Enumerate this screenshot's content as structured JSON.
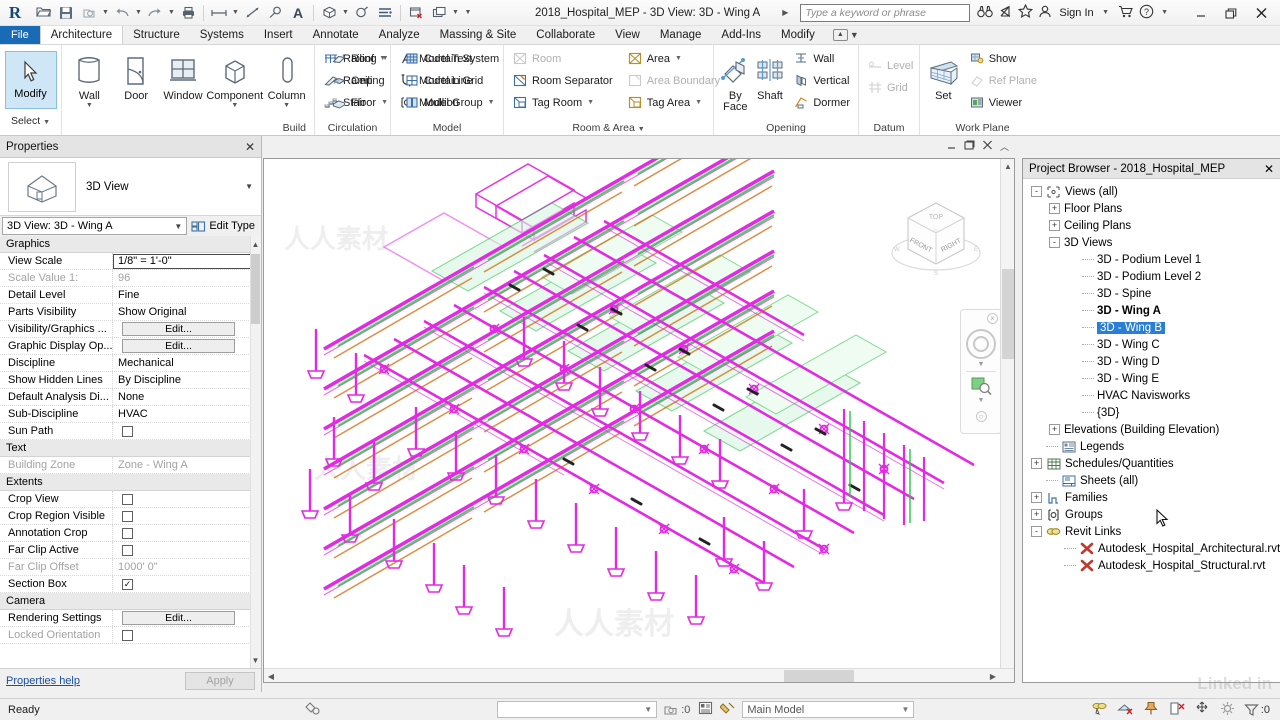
{
  "app": {
    "document_title": "2018_Hospital_MEP - 3D View: 3D - Wing A",
    "search_placeholder": "Type a keyword or phrase",
    "sign_in": "Sign In"
  },
  "quick_access": [
    {
      "name": "open-icon",
      "glyph": "↗"
    },
    {
      "name": "save-icon",
      "glyph": "ὋE"
    },
    {
      "name": "save-as-icon",
      "glyph": "⬚"
    },
    {
      "name": "undo-icon",
      "glyph": "↶"
    },
    {
      "name": "redo-icon",
      "glyph": "↷"
    },
    {
      "name": "print-icon",
      "glyph": "⎙"
    },
    {
      "name": "measure-icon",
      "glyph": "↔"
    },
    {
      "name": "aligned-dimension-icon",
      "glyph": "⤡"
    },
    {
      "name": "tag-icon",
      "glyph": "ⓘ"
    },
    {
      "name": "text-icon",
      "glyph": "A"
    },
    {
      "name": "default-3d-view-icon",
      "glyph": "⬜"
    },
    {
      "name": "section-icon",
      "glyph": "○"
    },
    {
      "name": "thin-lines-icon",
      "glyph": "≡"
    },
    {
      "name": "close-hidden-windows-icon",
      "glyph": "▧"
    },
    {
      "name": "switch-windows-icon",
      "glyph": "❐"
    }
  ],
  "ribbon": {
    "file_tab": "File",
    "tabs": [
      "Architecture",
      "Structure",
      "Systems",
      "Insert",
      "Annotate",
      "Analyze",
      "Massing & Site",
      "Collaborate",
      "View",
      "Manage",
      "Add-Ins",
      "Modify"
    ],
    "active_tab": "Architecture",
    "select_panel": {
      "modify_label": "Modify",
      "select_label": "Select",
      "title": ""
    },
    "panels": [
      {
        "title": "Build",
        "big_buttons": [
          {
            "label": "Wall",
            "icon": "wall-icon",
            "has_caret": true
          },
          {
            "label": "Door",
            "icon": "door-icon",
            "has_caret": false
          },
          {
            "label": "Window",
            "icon": "window-icon",
            "has_caret": false
          },
          {
            "label": "Component",
            "icon": "component-icon",
            "has_caret": true
          },
          {
            "label": "Column",
            "icon": "column-icon",
            "has_caret": true
          }
        ],
        "columns": [
          [
            {
              "label": "Roof",
              "icon": "roof-icon",
              "caret": true,
              "disabled": false
            },
            {
              "label": "Ceiling",
              "icon": "ceiling-icon",
              "caret": false,
              "disabled": false
            },
            {
              "label": "Floor",
              "icon": "floor-icon",
              "caret": true,
              "disabled": false
            }
          ],
          [
            {
              "label": "Curtain System",
              "icon": "curtain-system-icon",
              "caret": false,
              "disabled": false
            },
            {
              "label": "Curtain Grid",
              "icon": "curtain-grid-icon",
              "caret": false,
              "disabled": false
            },
            {
              "label": "Mullion",
              "icon": "mullion-icon",
              "caret": false,
              "disabled": false
            }
          ]
        ]
      },
      {
        "title": "Circulation",
        "big_buttons": [],
        "columns": [
          [
            {
              "label": "Railing",
              "icon": "railing-icon",
              "caret": true,
              "disabled": false
            },
            {
              "label": "Ramp",
              "icon": "ramp-icon",
              "caret": false,
              "disabled": false
            },
            {
              "label": "Stair",
              "icon": "stair-icon",
              "caret": false,
              "disabled": false
            }
          ]
        ]
      },
      {
        "title": "Model",
        "big_buttons": [],
        "columns": [
          [
            {
              "label": "Model Text",
              "icon": "model-text-icon",
              "caret": false,
              "disabled": false
            },
            {
              "label": "Model Line",
              "icon": "model-line-icon",
              "caret": false,
              "disabled": false
            },
            {
              "label": "Model Group",
              "icon": "model-group-icon",
              "caret": true,
              "disabled": false
            }
          ]
        ]
      },
      {
        "title": "Room & Area",
        "big_buttons": [],
        "columns": [
          [
            {
              "label": "Room",
              "icon": "room-icon",
              "caret": false,
              "disabled": true
            },
            {
              "label": "Room Separator",
              "icon": "room-separator-icon",
              "caret": false,
              "disabled": false
            },
            {
              "label": "Tag Room",
              "icon": "tag-room-icon",
              "caret": true,
              "disabled": false
            }
          ],
          [
            {
              "label": "Area",
              "icon": "area-icon",
              "caret": true,
              "disabled": false
            },
            {
              "label": "Area Boundary",
              "icon": "area-boundary-icon",
              "caret": false,
              "disabled": true
            },
            {
              "label": "Tag Area",
              "icon": "tag-area-icon",
              "caret": true,
              "disabled": false
            }
          ]
        ]
      },
      {
        "title": "Opening",
        "big_buttons": [
          {
            "label": "By Face",
            "icon": "by-face-icon",
            "has_caret": false
          },
          {
            "label": "Shaft",
            "icon": "shaft-icon",
            "has_caret": false
          }
        ],
        "columns": [
          [
            {
              "label": "Wall",
              "icon": "wall-opening-icon",
              "caret": false,
              "disabled": false
            },
            {
              "label": "Vertical",
              "icon": "vertical-opening-icon",
              "caret": false,
              "disabled": false
            },
            {
              "label": "Dormer",
              "icon": "dormer-opening-icon",
              "caret": false,
              "disabled": false
            }
          ]
        ]
      },
      {
        "title": "Datum",
        "big_buttons": [],
        "columns": [
          [
            {
              "label": "Level",
              "icon": "level-icon",
              "caret": false,
              "disabled": true
            },
            {
              "label": "Grid",
              "icon": "grid-icon",
              "caret": false,
              "disabled": true
            }
          ]
        ]
      },
      {
        "title": "Work Plane",
        "big_buttons": [
          {
            "label": "Set",
            "icon": "set-workplane-icon",
            "has_caret": false
          }
        ],
        "columns": [
          [
            {
              "label": "Show",
              "icon": "show-workplane-icon",
              "caret": false,
              "disabled": false
            },
            {
              "label": "Ref Plane",
              "icon": "ref-plane-icon",
              "caret": false,
              "disabled": true
            },
            {
              "label": "Viewer",
              "icon": "workplane-viewer-icon",
              "caret": false,
              "disabled": false
            }
          ]
        ]
      }
    ]
  },
  "properties": {
    "panel_title": "Properties",
    "type_label": "3D View",
    "selector_value": "3D View: 3D - Wing A",
    "edit_type_label": "Edit Type",
    "help_label": "Properties help",
    "apply_label": "Apply",
    "sections": [
      {
        "name": "Graphics",
        "rows": [
          {
            "name": "View Scale",
            "value": "1/8\" = 1'-0\"",
            "kind": "boxed",
            "disabled": false
          },
          {
            "name": "Scale Value    1:",
            "value": "96",
            "kind": "text",
            "disabled": true
          },
          {
            "name": "Detail Level",
            "value": "Fine",
            "kind": "text",
            "disabled": false
          },
          {
            "name": "Parts Visibility",
            "value": "Show Original",
            "kind": "text",
            "disabled": false
          },
          {
            "name": "Visibility/Graphics ...",
            "value": "Edit...",
            "kind": "button",
            "disabled": false
          },
          {
            "name": "Graphic Display Op...",
            "value": "Edit...",
            "kind": "button",
            "disabled": false
          },
          {
            "name": "Discipline",
            "value": "Mechanical",
            "kind": "text",
            "disabled": false
          },
          {
            "name": "Show Hidden Lines",
            "value": "By Discipline",
            "kind": "text",
            "disabled": false
          },
          {
            "name": "Default Analysis Di...",
            "value": "None",
            "kind": "text",
            "disabled": false
          },
          {
            "name": "Sub-Discipline",
            "value": "HVAC",
            "kind": "text",
            "disabled": false
          },
          {
            "name": "Sun Path",
            "value": "",
            "kind": "checkbox",
            "checked": false,
            "disabled": false
          }
        ]
      },
      {
        "name": "Text",
        "rows": [
          {
            "name": "Building Zone",
            "value": "Zone - Wing A",
            "kind": "text",
            "disabled": true
          }
        ]
      },
      {
        "name": "Extents",
        "rows": [
          {
            "name": "Crop View",
            "value": "",
            "kind": "checkbox",
            "checked": false,
            "disabled": false
          },
          {
            "name": "Crop Region Visible",
            "value": "",
            "kind": "checkbox",
            "checked": false,
            "disabled": false
          },
          {
            "name": "Annotation Crop",
            "value": "",
            "kind": "checkbox",
            "checked": false,
            "disabled": false
          },
          {
            "name": "Far Clip Active",
            "value": "",
            "kind": "checkbox",
            "checked": false,
            "disabled": false
          },
          {
            "name": "Far Clip Offset",
            "value": "1000'  0\"",
            "kind": "text",
            "disabled": true
          },
          {
            "name": "Section Box",
            "value": "",
            "kind": "checkbox",
            "checked": true,
            "disabled": false
          }
        ]
      },
      {
        "name": "Camera",
        "rows": [
          {
            "name": "Rendering Settings",
            "value": "Edit...",
            "kind": "button",
            "disabled": false
          },
          {
            "name": "Locked Orientation",
            "value": "",
            "kind": "checkbox",
            "checked": false,
            "disabled": true
          }
        ]
      }
    ]
  },
  "project_browser": {
    "panel_title": "Project Browser - 2018_Hospital_MEP",
    "nodes": [
      {
        "label": "Views (all)",
        "indent": 0,
        "expander": "-",
        "icon": "views-icon",
        "style": "normal"
      },
      {
        "label": "Floor Plans",
        "indent": 1,
        "expander": "+",
        "icon": "",
        "style": "normal"
      },
      {
        "label": "Ceiling Plans",
        "indent": 1,
        "expander": "+",
        "icon": "",
        "style": "normal"
      },
      {
        "label": "3D Views",
        "indent": 1,
        "expander": "-",
        "icon": "",
        "style": "normal"
      },
      {
        "label": "3D - Podium Level 1",
        "indent": 2,
        "expander": "",
        "icon": "",
        "style": "normal"
      },
      {
        "label": "3D - Podium Level 2",
        "indent": 2,
        "expander": "",
        "icon": "",
        "style": "normal"
      },
      {
        "label": "3D - Spine",
        "indent": 2,
        "expander": "",
        "icon": "",
        "style": "normal"
      },
      {
        "label": "3D - Wing A",
        "indent": 2,
        "expander": "",
        "icon": "",
        "style": "bold"
      },
      {
        "label": "3D - Wing B",
        "indent": 2,
        "expander": "",
        "icon": "",
        "style": "selected"
      },
      {
        "label": "3D - Wing C",
        "indent": 2,
        "expander": "",
        "icon": "",
        "style": "normal"
      },
      {
        "label": "3D - Wing D",
        "indent": 2,
        "expander": "",
        "icon": "",
        "style": "normal"
      },
      {
        "label": "3D - Wing E",
        "indent": 2,
        "expander": "",
        "icon": "",
        "style": "normal"
      },
      {
        "label": "HVAC Navisworks",
        "indent": 2,
        "expander": "",
        "icon": "",
        "style": "normal"
      },
      {
        "label": "{3D}",
        "indent": 2,
        "expander": "",
        "icon": "",
        "style": "normal"
      },
      {
        "label": "Elevations (Building Elevation)",
        "indent": 1,
        "expander": "+",
        "icon": "",
        "style": "normal"
      },
      {
        "label": "Legends",
        "indent": 0,
        "expander": "",
        "icon": "legends-icon",
        "style": "normal"
      },
      {
        "label": "Schedules/Quantities",
        "indent": 0,
        "expander": "+",
        "icon": "schedule-icon",
        "style": "normal"
      },
      {
        "label": "Sheets (all)",
        "indent": 0,
        "expander": "",
        "icon": "sheets-icon",
        "style": "normal"
      },
      {
        "label": "Families",
        "indent": 0,
        "expander": "+",
        "icon": "families-icon",
        "style": "normal"
      },
      {
        "label": "Groups",
        "indent": 0,
        "expander": "+",
        "icon": "groups-icon",
        "style": "normal"
      },
      {
        "label": "Revit Links",
        "indent": 0,
        "expander": "-",
        "icon": "links-icon",
        "style": "normal"
      },
      {
        "label": "Autodesk_Hospital_Architectural.rvt",
        "indent": 1,
        "expander": "",
        "icon": "rvt-link-icon",
        "style": "normal"
      },
      {
        "label": "Autodesk_Hospital_Structural.rvt",
        "indent": 1,
        "expander": "",
        "icon": "rvt-link-icon",
        "style": "normal"
      }
    ]
  },
  "view_cube": {
    "top_face": "TOP",
    "front_face": "FRONT",
    "right_face": "RIGHT",
    "compass_marks": [
      "N",
      "E",
      "S",
      "W"
    ]
  },
  "canvas": {
    "minimize_glyph": "–",
    "restore_glyph": "❐",
    "close_glyph": "✖",
    "collapse_glyph": "˄"
  },
  "status_bar": {
    "ready_text": "Ready",
    "workset_value": "Main Model",
    "filter_count": ":0",
    "selection_count": ":0",
    "icons": [
      {
        "name": "design-options-icon"
      },
      {
        "name": "exclude-options-icon"
      },
      {
        "name": "editable-only-icon"
      },
      {
        "name": "select-links-icon"
      },
      {
        "name": "select-underlay-icon"
      },
      {
        "name": "select-pinned-icon"
      },
      {
        "name": "select-by-face-icon"
      },
      {
        "name": "drag-elements-icon"
      },
      {
        "name": "settings-icon"
      },
      {
        "name": "filter-icon"
      }
    ]
  },
  "watermarks": {
    "brand": "Linked in",
    "site": "人人素材"
  },
  "colors": {
    "accent_blue": "#1a6bb5",
    "selection_blue": "#2a7fd4",
    "modify_highlight": "#cfe6f7",
    "model_magenta": "#e32ae3",
    "model_green": "#2fc24a",
    "model_orange": "#d4721a",
    "link_text": "#1b4fa0"
  }
}
